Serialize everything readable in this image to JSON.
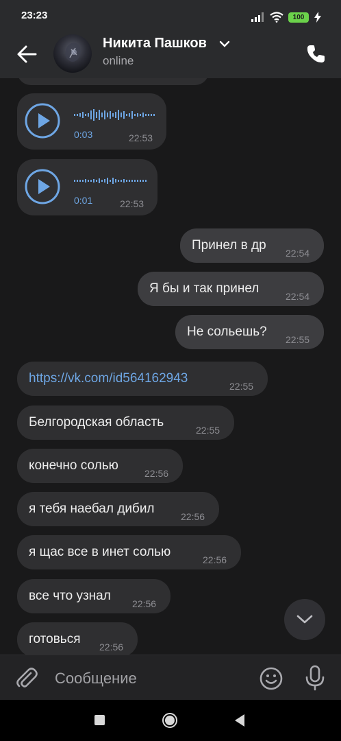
{
  "status_bar": {
    "time": "23:23",
    "battery": "100",
    "icons": [
      "signal-icon",
      "wifi-icon",
      "battery-icon",
      "charging-icon"
    ]
  },
  "header": {
    "contact_name": "Никита Пашков",
    "status": "online",
    "icons": [
      "back-arrow-icon",
      "chevron-down-icon",
      "phone-icon"
    ]
  },
  "messages": [
    {
      "direction": "in",
      "type": "voice",
      "duration": "0:03",
      "time": "22:53"
    },
    {
      "direction": "in",
      "type": "voice",
      "duration": "0:01",
      "time": "22:53"
    },
    {
      "direction": "out",
      "type": "text",
      "text": "Принел в др",
      "time": "22:54"
    },
    {
      "direction": "out",
      "type": "text",
      "text": "Я бы и так принел",
      "time": "22:54"
    },
    {
      "direction": "out",
      "type": "text",
      "text": "Не сольешь?",
      "time": "22:55"
    },
    {
      "direction": "in",
      "type": "link",
      "text": "https://vk.com/id564162943",
      "time": "22:55"
    },
    {
      "direction": "in",
      "type": "text",
      "text": "Белгородская область",
      "time": "22:55"
    },
    {
      "direction": "in",
      "type": "text",
      "text": "конечно солью",
      "time": "22:56"
    },
    {
      "direction": "in",
      "type": "text",
      "text": "я тебя наебал дибил",
      "time": "22:56"
    },
    {
      "direction": "in",
      "type": "text",
      "text": "я щас все в инет солью",
      "time": "22:56"
    },
    {
      "direction": "in",
      "type": "text",
      "text": "все что узнал",
      "time": "22:56"
    },
    {
      "direction": "in",
      "type": "text",
      "text": "готовься",
      "time": "22:56"
    }
  ],
  "composer": {
    "placeholder": "Сообщение",
    "icons": [
      "paperclip-icon",
      "emoji-icon",
      "microphone-icon"
    ]
  },
  "colors": {
    "background": "#19191a",
    "header": "#2a2b2d",
    "incoming_bubble": "#2f2f31",
    "outgoing_bubble": "#3d3d40",
    "accent": "#6ea6e4",
    "battery": "#6bd24b"
  }
}
